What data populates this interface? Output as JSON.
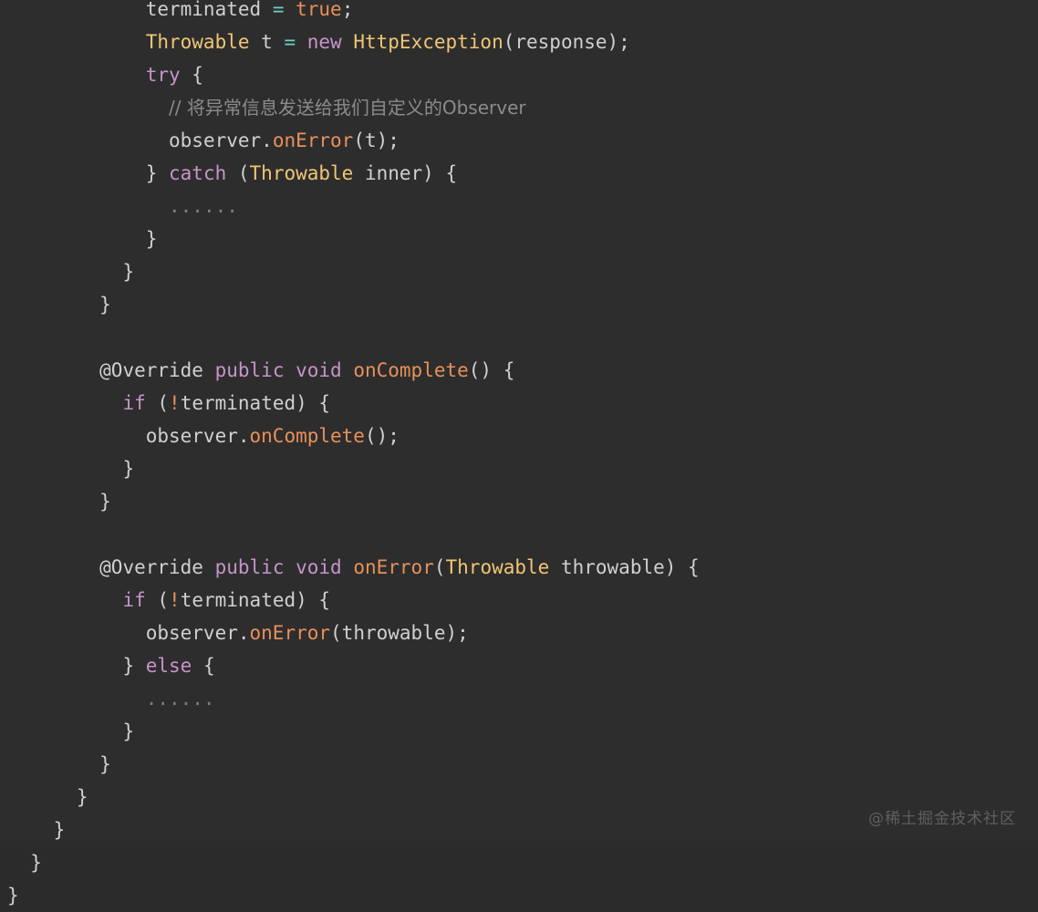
{
  "editor": {
    "background_color": "#2d2d2d",
    "language": "java",
    "font_size_px": 21,
    "line_height_px": 36,
    "colors": {
      "plain": "#d0d0d0",
      "keyword": "#c694c9",
      "type": "#f0c674",
      "function": "#e8905a",
      "constant": "#e8905a",
      "operator": "#6fcfc4",
      "comment": "#8b8b8b",
      "ellipsis": "#7e7e7e",
      "watermark": "#5f5f5f"
    }
  },
  "code": {
    "lines": [
      {
        "indent": 0,
        "clipped_top": true,
        "tokens": [
          {
            "t": "            ",
            "c": "plain"
          },
          {
            "t": "terminated",
            "c": "plain"
          },
          {
            "t": " ",
            "c": "plain"
          },
          {
            "t": "=",
            "c": "operator"
          },
          {
            "t": " ",
            "c": "plain"
          },
          {
            "t": "true",
            "c": "constant"
          },
          {
            "t": ";",
            "c": "plain"
          }
        ]
      },
      {
        "indent": 0,
        "tokens": [
          {
            "t": "            ",
            "c": "plain"
          },
          {
            "t": "Throwable",
            "c": "type"
          },
          {
            "t": " t ",
            "c": "plain"
          },
          {
            "t": "=",
            "c": "operator"
          },
          {
            "t": " ",
            "c": "plain"
          },
          {
            "t": "new",
            "c": "keyword"
          },
          {
            "t": " ",
            "c": "plain"
          },
          {
            "t": "HttpException",
            "c": "type"
          },
          {
            "t": "(response);",
            "c": "plain"
          }
        ]
      },
      {
        "indent": 0,
        "tokens": [
          {
            "t": "            ",
            "c": "plain"
          },
          {
            "t": "try",
            "c": "keyword"
          },
          {
            "t": " {",
            "c": "plain"
          }
        ]
      },
      {
        "indent": 0,
        "tokens": [
          {
            "t": "              ",
            "c": "plain"
          },
          {
            "t": "// 将异常信息发送给我们自定义的Observer",
            "c": "comment",
            "cjk": true
          }
        ]
      },
      {
        "indent": 0,
        "tokens": [
          {
            "t": "              ",
            "c": "plain"
          },
          {
            "t": "observer.",
            "c": "plain"
          },
          {
            "t": "onError",
            "c": "function"
          },
          {
            "t": "(t);",
            "c": "plain"
          }
        ]
      },
      {
        "indent": 0,
        "tokens": [
          {
            "t": "            ",
            "c": "plain"
          },
          {
            "t": "} ",
            "c": "plain"
          },
          {
            "t": "catch",
            "c": "keyword"
          },
          {
            "t": " (",
            "c": "plain"
          },
          {
            "t": "Throwable",
            "c": "type"
          },
          {
            "t": " inner) {",
            "c": "plain"
          }
        ]
      },
      {
        "indent": 0,
        "tokens": [
          {
            "t": "              ",
            "c": "plain"
          },
          {
            "t": "......",
            "c": "ellipsis"
          }
        ]
      },
      {
        "indent": 0,
        "tokens": [
          {
            "t": "            ",
            "c": "plain"
          },
          {
            "t": "}",
            "c": "plain"
          }
        ]
      },
      {
        "indent": 0,
        "tokens": [
          {
            "t": "          ",
            "c": "plain"
          },
          {
            "t": "}",
            "c": "plain"
          }
        ]
      },
      {
        "indent": 0,
        "tokens": [
          {
            "t": "        ",
            "c": "plain"
          },
          {
            "t": "}",
            "c": "plain"
          }
        ]
      },
      {
        "indent": 0,
        "blank": true,
        "tokens": []
      },
      {
        "indent": 0,
        "tokens": [
          {
            "t": "        ",
            "c": "plain"
          },
          {
            "t": "@Override",
            "c": "annot"
          },
          {
            "t": " ",
            "c": "plain"
          },
          {
            "t": "public void",
            "c": "keyword"
          },
          {
            "t": " ",
            "c": "plain"
          },
          {
            "t": "onComplete",
            "c": "function"
          },
          {
            "t": "() {",
            "c": "plain"
          }
        ]
      },
      {
        "indent": 0,
        "tokens": [
          {
            "t": "          ",
            "c": "plain"
          },
          {
            "t": "if",
            "c": "keyword"
          },
          {
            "t": " (",
            "c": "plain"
          },
          {
            "t": "!",
            "c": "constant"
          },
          {
            "t": "terminated) {",
            "c": "plain"
          }
        ]
      },
      {
        "indent": 0,
        "tokens": [
          {
            "t": "            ",
            "c": "plain"
          },
          {
            "t": "observer.",
            "c": "plain"
          },
          {
            "t": "onComplete",
            "c": "function"
          },
          {
            "t": "();",
            "c": "plain"
          }
        ]
      },
      {
        "indent": 0,
        "tokens": [
          {
            "t": "          ",
            "c": "plain"
          },
          {
            "t": "}",
            "c": "plain"
          }
        ]
      },
      {
        "indent": 0,
        "tokens": [
          {
            "t": "        ",
            "c": "plain"
          },
          {
            "t": "}",
            "c": "plain"
          }
        ]
      },
      {
        "indent": 0,
        "blank": true,
        "tokens": []
      },
      {
        "indent": 0,
        "tokens": [
          {
            "t": "        ",
            "c": "plain"
          },
          {
            "t": "@Override",
            "c": "annot"
          },
          {
            "t": " ",
            "c": "plain"
          },
          {
            "t": "public void",
            "c": "keyword"
          },
          {
            "t": " ",
            "c": "plain"
          },
          {
            "t": "onError",
            "c": "function"
          },
          {
            "t": "(",
            "c": "plain"
          },
          {
            "t": "Throwable",
            "c": "type"
          },
          {
            "t": " throwable) {",
            "c": "plain"
          }
        ]
      },
      {
        "indent": 0,
        "tokens": [
          {
            "t": "          ",
            "c": "plain"
          },
          {
            "t": "if",
            "c": "keyword"
          },
          {
            "t": " (",
            "c": "plain"
          },
          {
            "t": "!",
            "c": "constant"
          },
          {
            "t": "terminated) {",
            "c": "plain"
          }
        ]
      },
      {
        "indent": 0,
        "tokens": [
          {
            "t": "            ",
            "c": "plain"
          },
          {
            "t": "observer.",
            "c": "plain"
          },
          {
            "t": "onError",
            "c": "function"
          },
          {
            "t": "(throwable);",
            "c": "plain"
          }
        ]
      },
      {
        "indent": 0,
        "tokens": [
          {
            "t": "          ",
            "c": "plain"
          },
          {
            "t": "} ",
            "c": "plain"
          },
          {
            "t": "else",
            "c": "keyword"
          },
          {
            "t": " {",
            "c": "plain"
          }
        ]
      },
      {
        "indent": 0,
        "tokens": [
          {
            "t": "            ",
            "c": "plain"
          },
          {
            "t": "......",
            "c": "ellipsis"
          }
        ]
      },
      {
        "indent": 0,
        "tokens": [
          {
            "t": "          ",
            "c": "plain"
          },
          {
            "t": "}",
            "c": "plain"
          }
        ]
      },
      {
        "indent": 0,
        "tokens": [
          {
            "t": "        ",
            "c": "plain"
          },
          {
            "t": "}",
            "c": "plain"
          }
        ]
      },
      {
        "indent": 0,
        "tokens": [
          {
            "t": "      ",
            "c": "plain"
          },
          {
            "t": "}",
            "c": "plain"
          }
        ]
      },
      {
        "indent": 0,
        "tokens": [
          {
            "t": "    ",
            "c": "plain"
          },
          {
            "t": "}",
            "c": "plain"
          }
        ]
      },
      {
        "indent": 0,
        "tokens": [
          {
            "t": "  ",
            "c": "plain"
          },
          {
            "t": "}",
            "c": "plain"
          }
        ]
      },
      {
        "indent": 0,
        "tokens": [
          {
            "t": "}",
            "c": "plain"
          }
        ]
      }
    ]
  },
  "watermark": {
    "text": "@稀土掘金技术社区"
  }
}
